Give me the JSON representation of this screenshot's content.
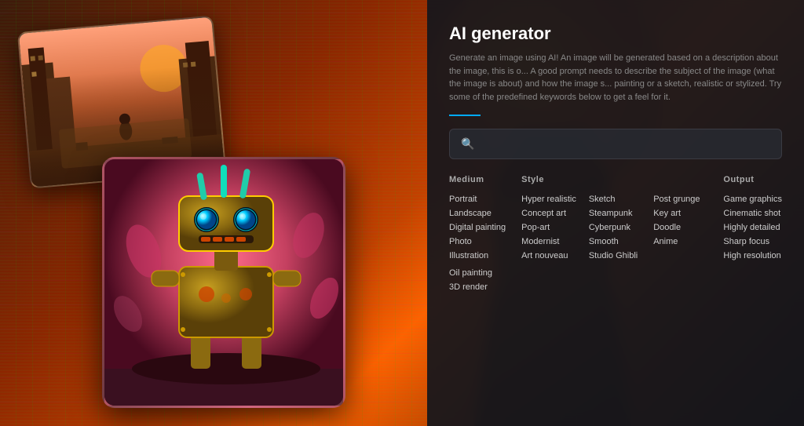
{
  "background": {
    "colors": {
      "primary": "#3d1a0a",
      "secondary": "#c44000",
      "accent": "#ff6000"
    }
  },
  "panel": {
    "title": "AI generator",
    "description": "Generate an image using AI! An image will be generated based on a description about the image, this is o... A good prompt needs to describe the subject of the image (what the image is about) and how the image s... painting or a sketch, realistic or stylized. Try some of the predefined keywords below to get a feel for it.",
    "search_placeholder": "",
    "search_icon": "🔍",
    "divider_color": "#00aaff"
  },
  "keywords": {
    "medium": {
      "header": "Medium",
      "items": [
        "Portrait",
        "Landscape",
        "Digital painting",
        "Photo",
        "Illustration"
      ],
      "sub_items": [
        "Oil painting",
        "3D render"
      ]
    },
    "style": {
      "header": "Style",
      "col1": [
        "Hyper realistic",
        "Concept art",
        "Pop-art",
        "Modernist",
        "Art nouveau"
      ],
      "col2": [
        "Sketch",
        "Steampunk",
        "Cyberpunk",
        "Smooth",
        "Studio Ghibli"
      ]
    },
    "style_col3": {
      "items": [
        "Post grunge",
        "Key art",
        "Doodle",
        "Anime"
      ]
    },
    "output": {
      "header": "Output",
      "items": [
        "Game graphics",
        "Cinematic shot",
        "Highly detailed",
        "Sharp focus",
        "High resolution"
      ]
    }
  },
  "images": {
    "card1_alt": "Post-apocalyptic street scene",
    "card2_alt": "Steampunk robot character"
  }
}
